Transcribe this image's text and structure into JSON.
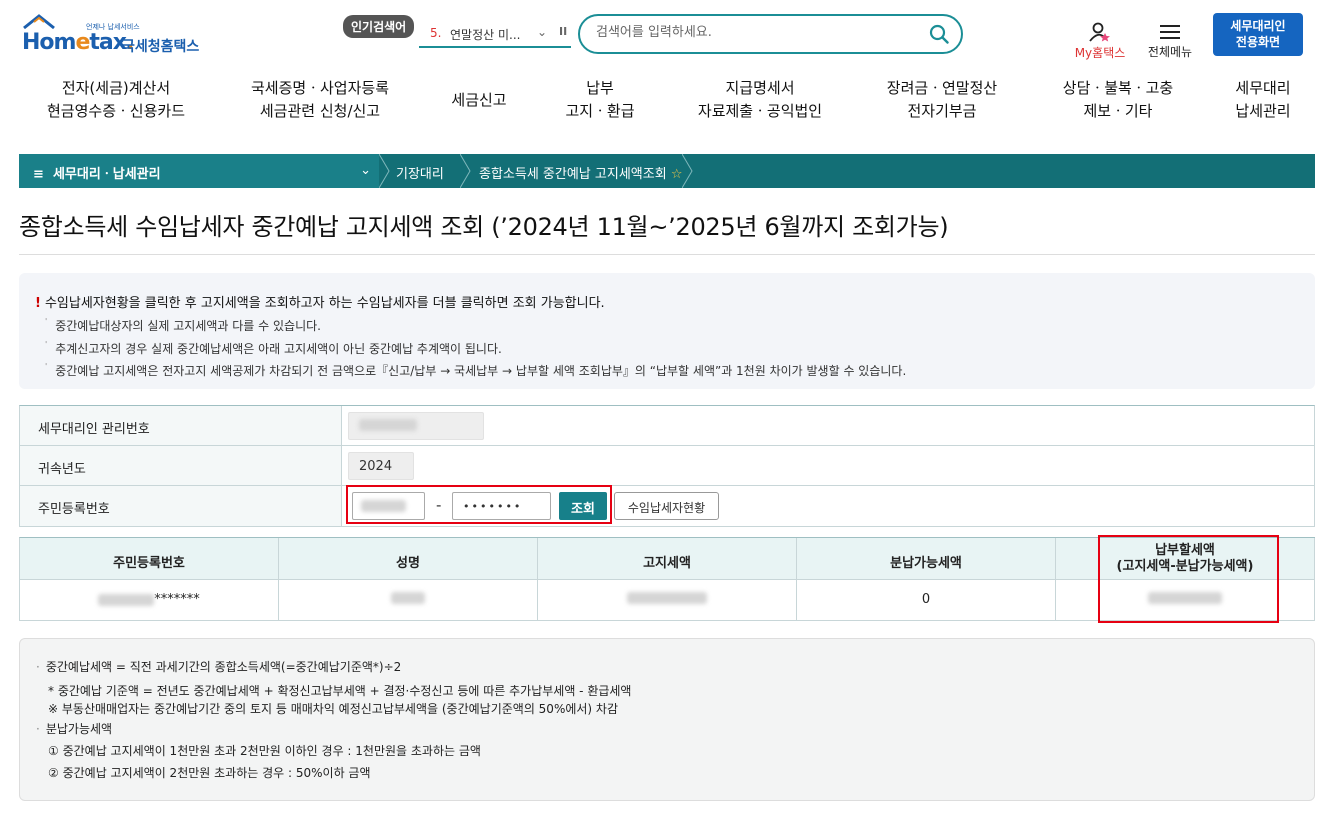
{
  "header": {
    "logo_small": "언제나 납세서비스",
    "logo_text_1": "Hom",
    "logo_text_e": "e",
    "logo_text_2": "tax",
    "logo_dot": ".",
    "logo_korean": "국세청홈택스",
    "popular_label": "인기검색어",
    "popular_rank": "5.",
    "popular_term": "연말정산 미...",
    "search_placeholder": "검색어를 입력하세요.",
    "my_hometax": "My홈택스",
    "all_menu": "전체메뉴",
    "tax_agent_btn_line1": "세무대리인",
    "tax_agent_btn_line2": "전용화면"
  },
  "main_nav": [
    {
      "line1": "전자(세금)계산서",
      "line2": "현금영수증ㆍ신용카드"
    },
    {
      "line1": "국세증명ㆍ사업자등록",
      "line2": "세금관련 신청/신고"
    },
    {
      "line1": "세금신고",
      "line2": ""
    },
    {
      "line1": "납부",
      "line2": "고지ㆍ환급"
    },
    {
      "line1": "지급명세서",
      "line2": "자료제출ㆍ공익법인"
    },
    {
      "line1": "장려금ㆍ연말정산",
      "line2": "전자기부금"
    },
    {
      "line1": "상담ㆍ불복ㆍ고충",
      "line2": "제보ㆍ기타"
    },
    {
      "line1": "세무대리",
      "line2": "납세관리"
    }
  ],
  "breadcrumb": {
    "menu": "세무대리ㆍ납세관리",
    "level2": "기장대리",
    "level3": "종합소득세 중간예납 고지세액조회"
  },
  "page_title": "종합소득세 수임납세자 중간예납 고지세액 조회 (’2024년 11월~’2025년 6월까지 조회가능)",
  "notice": {
    "main": "수임납세자현황을 클릭한 후 고지세액을 조회하고자 하는 수임납세자를 더블 클릭하면 조회 가능합니다.",
    "items": [
      "중간예납대상자의 실제 고지세액과 다를 수 있습니다.",
      "추계신고자의 경우 실제 중간예납세액은 아래 고지세액이 아닌 중간예납 추계액이 됩니다.",
      "중간예납 고지세액은 전자고지 세액공제가 차감되기 전 금액으로『신고/납부 → 국세납부 → 납부할 세액 조회납부』의 “납부할 세액”과 1천원 차이가 발생할 수 있습니다."
    ]
  },
  "form": {
    "agent_no_label": "세무대리인 관리번호",
    "year_label": "귀속년도",
    "year_value": "2024",
    "rrn_label": "주민등록번호",
    "rrn_dash": "-",
    "rrn_back_masked": "•••••••",
    "query_btn": "조회",
    "status_btn": "수임납세자현황"
  },
  "results": {
    "headers": [
      "주민등록번호",
      "성명",
      "고지세액",
      "분납가능세액"
    ],
    "last_header_line1": "납부할세액",
    "last_header_line2": "(고지세액-분납가능세액)",
    "row": {
      "rrn_suffix": "*******",
      "installment": "0"
    }
  },
  "formula": {
    "lines": [
      "중간예납세액 = 직전 과세기간의 종합소득세액(=중간예납기준액*)÷2",
      "* 중간예납 기준액 = 전년도 중간예납세액 + 확정신고납부세액 + 결정·수정신고 등에 따른 추가납부세액 - 환급세액",
      "※ 부동산매매업자는 중간예납기간 중의 토지 등 매매차익 예정신고납부세액을 (중간예납기준액의 50%에서) 차감",
      "분납가능세액",
      "① 중간예납 고지세액이 1천만원 초과 2천만원 이하인 경우 : 1천만원을 초과하는 금액",
      "② 중간예납 고지세액이 2천만원 초과하는 경우 : 50%이하 금액"
    ]
  },
  "colors": {
    "teal": "#136f76",
    "accent_blue": "#1565c0",
    "highlight_red": "#e60012"
  }
}
